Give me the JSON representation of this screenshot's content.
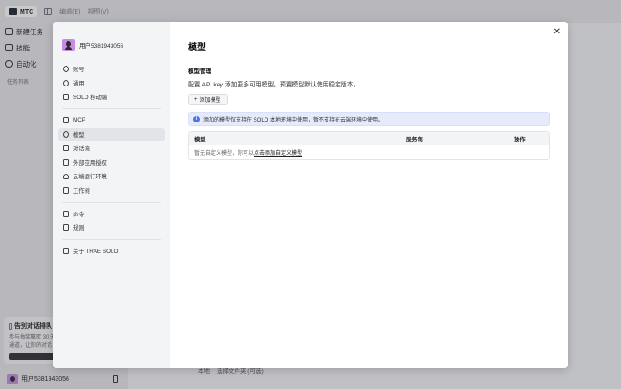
{
  "titlebar": {
    "app_name": "MTC",
    "menu_edit": "编辑(E)",
    "menu_view": "视图(V)"
  },
  "app_sidebar": {
    "items": [
      {
        "label": "新建任务",
        "icon": "new-task-icon"
      },
      {
        "label": "技能",
        "icon": "skills-icon"
      },
      {
        "label": "自动化",
        "icon": "automation-icon"
      }
    ],
    "section_label": "任务列表"
  },
  "promo": {
    "title": "告别对话排队",
    "line1": "参与抽奖赢取 30 天",
    "line2": "通道，让你的对话"
  },
  "bottom_user": {
    "name": "用户5381943056"
  },
  "composer": {
    "mode_label": "本地",
    "file_label": "选择文件夹 (可选)"
  },
  "modal": {
    "user_name": "用户5381943056",
    "groups": [
      {
        "items": [
          {
            "label": "账号",
            "icon": "account-icon"
          },
          {
            "label": "通用",
            "icon": "general-icon"
          },
          {
            "label": "SOLO 移动端",
            "icon": "mobile-icon"
          }
        ]
      },
      {
        "items": [
          {
            "label": "MCP",
            "icon": "mcp-icon"
          },
          {
            "label": "模型",
            "icon": "model-icon",
            "active": true
          },
          {
            "label": "对话流",
            "icon": "conversation-flow-icon"
          },
          {
            "label": "外部应用授权",
            "icon": "external-app-icon"
          },
          {
            "label": "云端运行环境",
            "icon": "cloud-icon"
          },
          {
            "label": "工作树",
            "icon": "worktree-icon"
          }
        ]
      },
      {
        "items": [
          {
            "label": "命令",
            "icon": "command-icon"
          },
          {
            "label": "规则",
            "icon": "rules-icon"
          }
        ]
      },
      {
        "items": [
          {
            "label": "关于 TRAE SOLO",
            "icon": "about-icon"
          }
        ]
      }
    ],
    "content": {
      "title": "模型",
      "section_title": "模型管理",
      "description": "配置 API key 添加更多可用模型，预置模型默认使用稳定版本。",
      "add_button": "添加模型",
      "info_text": "添加的模型仅支持在 SOLO 本地环境中使用，暂不支持在云端环境中使用。",
      "table": {
        "columns": [
          "模型",
          "服务商",
          "操作"
        ],
        "empty_text": "暂无自定义模型，你可以",
        "empty_link": "点击添加自定义模型"
      }
    }
  }
}
